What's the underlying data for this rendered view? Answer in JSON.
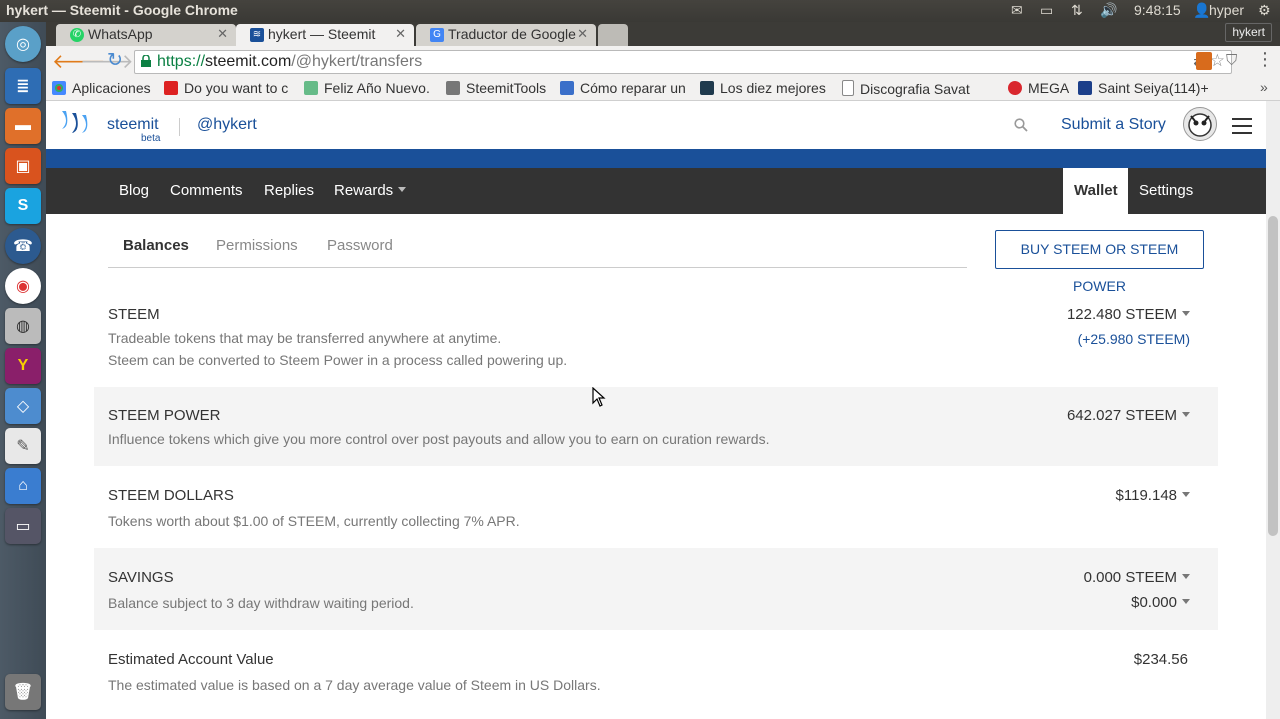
{
  "os": {
    "window_title": "hykert — Steemit - Google Chrome",
    "clock": "9:48:15",
    "user": "hyper"
  },
  "browser": {
    "tabs": [
      {
        "label": "WhatsApp",
        "icon": "whatsapp-icon"
      },
      {
        "label": "hykert — Steemit",
        "icon": "steemit-icon"
      },
      {
        "label": "Traductor de Google",
        "icon": "google-translate-icon"
      }
    ],
    "profile_badge": "hykert",
    "url": {
      "scheme": "https://",
      "host": "steemit.com",
      "path": "/@hykert/transfers"
    },
    "bookmarks": [
      {
        "label": "Aplicaciones",
        "icon": "apps-grid-icon"
      },
      {
        "label": "Do you want to c",
        "icon": "maple-leaf-icon"
      },
      {
        "label": "Feliz Año Nuevo.",
        "icon": "feather-icon"
      },
      {
        "label": "SteemitTools",
        "icon": "folder-icon"
      },
      {
        "label": "Cómo reparar un",
        "icon": "share-icon"
      },
      {
        "label": "Los diez mejores",
        "icon": "c-logo-icon"
      },
      {
        "label": "Discografia Savat",
        "icon": "page-icon"
      },
      {
        "label": "MEGA",
        "icon": "mega-icon"
      },
      {
        "label": "Saint Seiya(114)+",
        "icon": "bookmark-site-icon"
      }
    ]
  },
  "site": {
    "brand": "steemit",
    "brand_beta": "beta",
    "username": "@hykert",
    "submit_story": "Submit a Story",
    "nav": {
      "blog": "Blog",
      "comments": "Comments",
      "replies": "Replies",
      "rewards": "Rewards",
      "wallet": "Wallet",
      "settings": "Settings"
    },
    "subtabs": {
      "balances": "Balances",
      "permissions": "Permissions",
      "password": "Password"
    },
    "buy_button": "BUY STEEM OR STEEM POWER",
    "balances": {
      "steem": {
        "title": "STEEM",
        "desc1": "Tradeable tokens that may be transferred anywhere at anytime.",
        "desc2": "Steem can be converted to Steem Power in a process called powering up.",
        "value": "122.480 STEEM",
        "pending": "(+25.980 STEEM)"
      },
      "steem_power": {
        "title": "STEEM POWER",
        "desc": "Influence tokens which give you more control over post payouts and allow you to earn on curation rewards.",
        "value": "642.027 STEEM"
      },
      "steem_dollars": {
        "title": "STEEM DOLLARS",
        "desc": "Tokens worth about $1.00 of STEEM, currently collecting 7% APR.",
        "value": "$119.148"
      },
      "savings": {
        "title": "SAVINGS",
        "desc": "Balance subject to 3 day withdraw waiting period.",
        "value_steem": "0.000 STEEM",
        "value_usd": "$0.000"
      },
      "estimated": {
        "title": "Estimated Account Value",
        "desc": "The estimated value is based on a 7 day average value of Steem in US Dollars.",
        "value": "$234.56"
      }
    }
  },
  "colors": {
    "accent": "#1a5099",
    "nav_bg": "#333333"
  }
}
